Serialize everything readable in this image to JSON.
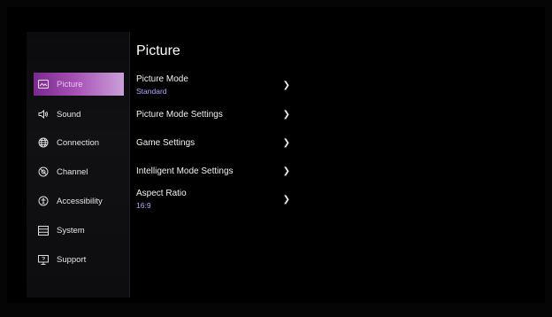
{
  "page": {
    "title": "Picture"
  },
  "sidebar": {
    "items": [
      {
        "label": "Picture",
        "icon": "picture-icon"
      },
      {
        "label": "Sound",
        "icon": "speaker-icon"
      },
      {
        "label": "Connection",
        "icon": "globe-icon"
      },
      {
        "label": "Channel",
        "icon": "channel-icon"
      },
      {
        "label": "Accessibility",
        "icon": "accessibility-icon"
      },
      {
        "label": "System",
        "icon": "system-icon"
      },
      {
        "label": "Support",
        "icon": "support-icon"
      }
    ],
    "active_index": 0
  },
  "settings": {
    "rows": [
      {
        "label": "Picture Mode",
        "value": "Standard"
      },
      {
        "label": "Picture Mode Settings"
      },
      {
        "label": "Game Settings"
      },
      {
        "label": "Intelligent Mode Settings"
      },
      {
        "label": "Aspect Ratio",
        "value": "16:9"
      }
    ]
  },
  "colors": {
    "accent": "#a64fb4",
    "value_text": "#b9a3ff"
  }
}
